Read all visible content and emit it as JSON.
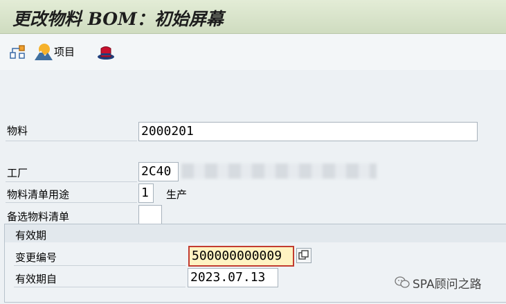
{
  "header": {
    "title": "更改物料 BOM：初始屏幕"
  },
  "toolbar": {
    "item_label": "项目"
  },
  "form": {
    "material": {
      "label": "物料",
      "value": "2000201"
    },
    "plant": {
      "label": "工厂",
      "value": "2C40"
    },
    "bom_usage": {
      "label": "物料清单用途",
      "value": "1",
      "desc": "生产"
    },
    "alt_bom": {
      "label": "备选物料清单",
      "value": ""
    }
  },
  "validity": {
    "title": "有效期",
    "change_number": {
      "label": "变更编号",
      "value": "500000000009"
    },
    "valid_from": {
      "label": "有效期自",
      "value": "2023.07.13"
    }
  },
  "watermark": {
    "text": "SPA顾问之路"
  },
  "icons": [
    "hierarchy-icon",
    "mountain-sun-icon",
    "hat-icon",
    "copy-icon",
    "wechat-icon"
  ]
}
